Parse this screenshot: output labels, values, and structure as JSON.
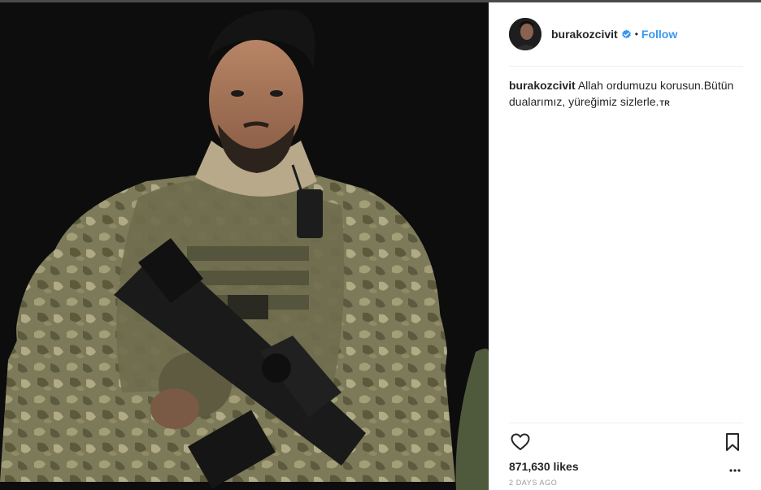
{
  "post": {
    "username": "burakozcivit",
    "verified_icon": "verified-badge-icon",
    "separator": "•",
    "follow_label": "Follow",
    "caption_user": "burakozcivit",
    "caption_text": "Allah ordumuzu korusun.Bütün dualarımız, yüreğimiz sizlerle.",
    "caption_lang": "TR",
    "likes": "871,630 likes",
    "time": "2 DAYS AGO"
  },
  "icons": {
    "like": "heart-outline-icon",
    "save": "bookmark-outline-icon",
    "more": "more-options-icon"
  },
  "colors": {
    "link": "#3897f0",
    "verified": "#3897f0",
    "text": "#262626",
    "muted": "#999999",
    "media_background": "#0d0d0d"
  }
}
